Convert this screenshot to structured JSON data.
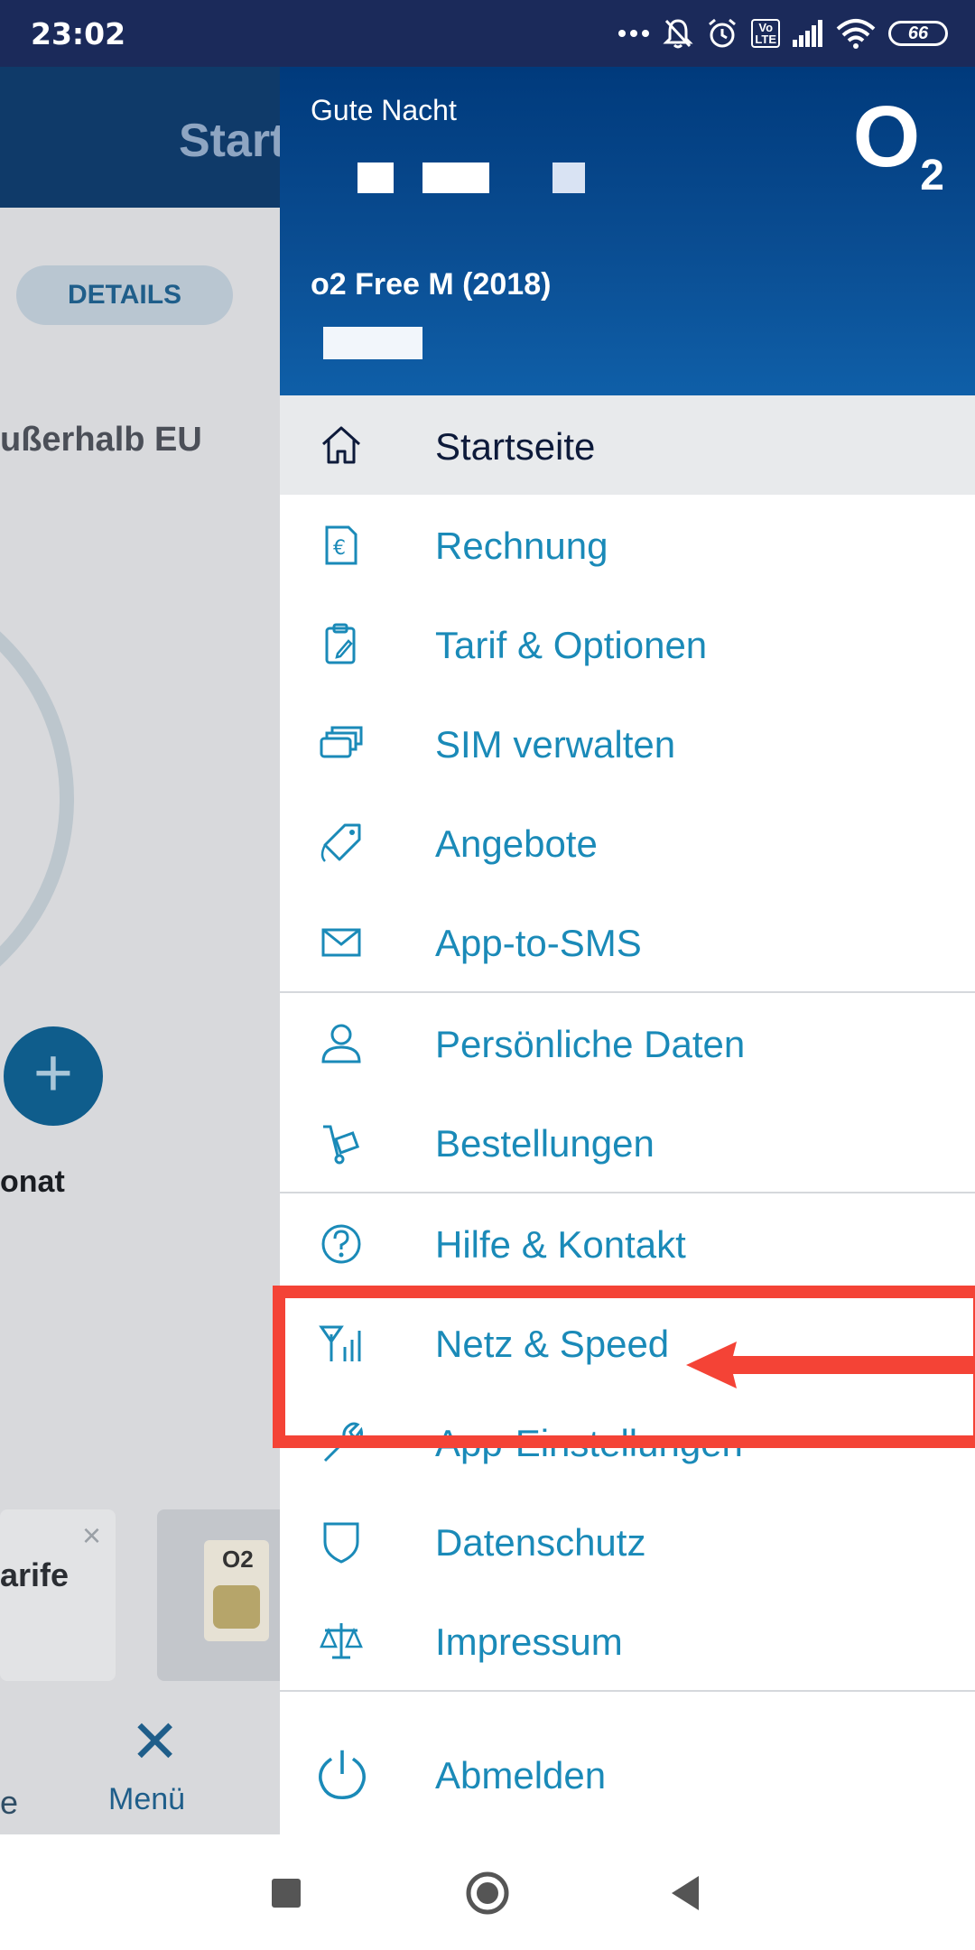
{
  "status_bar": {
    "time": "23:02",
    "volte_label": "Vo\nLTE",
    "battery": "66"
  },
  "background_app": {
    "header_title": "Start",
    "details_button": "DETAILS",
    "line1": "ußerhalb EU",
    "line2": "onat",
    "card1_label": "arife",
    "sim_brand": "O2",
    "bottom_left_label": "e",
    "menu_label": "Menü"
  },
  "drawer": {
    "greeting": "Gute Nacht",
    "tariff": "o2 Free M (2018)",
    "brand_logo": "O2",
    "items": [
      {
        "label": "Startseite",
        "icon": "home-icon"
      },
      {
        "label": "Rechnung",
        "icon": "invoice-euro-icon"
      },
      {
        "label": "Tarif & Optionen",
        "icon": "clipboard-edit-icon"
      },
      {
        "label": "SIM verwalten",
        "icon": "sim-cards-icon"
      },
      {
        "label": "Angebote",
        "icon": "tag-icon"
      },
      {
        "label": "App-to-SMS",
        "icon": "envelope-icon"
      },
      {
        "label": "Persönliche Daten",
        "icon": "person-icon"
      },
      {
        "label": "Bestellungen",
        "icon": "hand-truck-icon"
      },
      {
        "label": "Hilfe & Kontakt",
        "icon": "help-circle-icon"
      },
      {
        "label": "Netz & Speed",
        "icon": "antenna-signal-icon"
      },
      {
        "label": "App-Einstellungen",
        "icon": "wrench-icon"
      },
      {
        "label": "Datenschutz",
        "icon": "shield-icon"
      },
      {
        "label": "Impressum",
        "icon": "scales-icon"
      },
      {
        "label": "Abmelden",
        "icon": "power-icon"
      }
    ]
  },
  "colors": {
    "menu_text": "#1a8ab8",
    "active_text": "#0d1a3a",
    "header_blue": "#003a7c",
    "highlight_red": "#f44336"
  }
}
